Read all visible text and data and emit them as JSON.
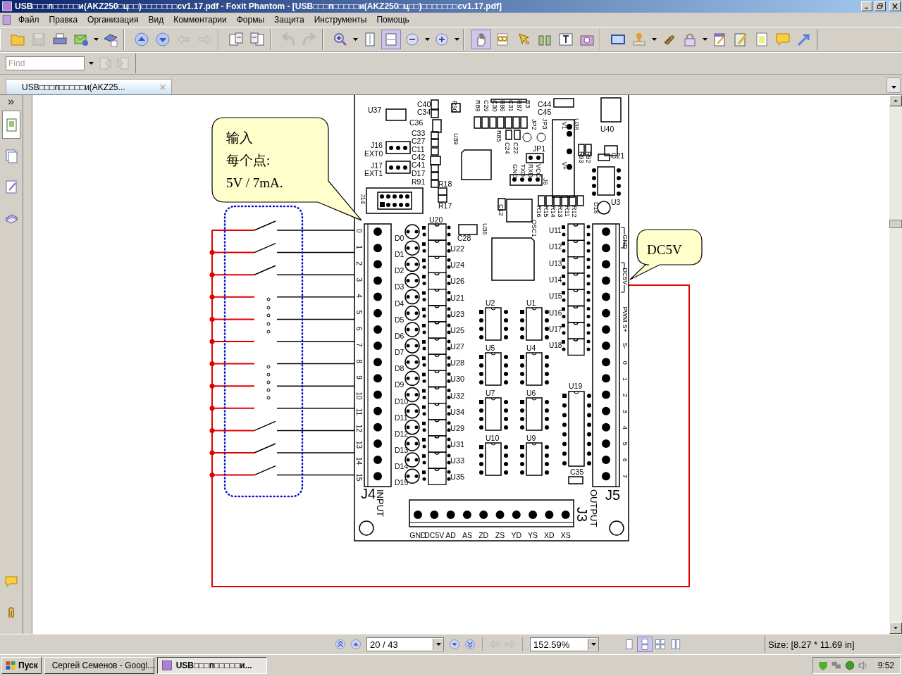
{
  "window": {
    "title": "USB□□□п□□□□□и(AKZ250□ц□□)□□□□□□□cv1.17.pdf - Foxit Phantom - [USB□□□п□□□□□и(AKZ250□ц□□)□□□□□□□cv1.17.pdf]"
  },
  "menu": [
    "Файл",
    "Правка",
    "Организация",
    "Вид",
    "Комментарии",
    "Формы",
    "Защита",
    "Инструменты",
    "Помощь"
  ],
  "toolbar": {
    "groups": [
      {
        "buttons": [
          {
            "selected": false,
            "disabled": false
          },
          {
            "selected": false,
            "disabled": true
          },
          {
            "selected": false,
            "disabled": false
          },
          {
            "selected": false,
            "disabled": false,
            "dropdown": true
          },
          {
            "selected": false,
            "disabled": false
          }
        ]
      },
      {
        "buttons": [
          {
            "selected": false,
            "disabled": false
          },
          {
            "selected": false,
            "disabled": false
          },
          {
            "selected": false,
            "disabled": true
          },
          {
            "selected": false,
            "disabled": true
          }
        ]
      },
      {
        "buttons": [
          {
            "selected": false,
            "disabled": false
          },
          {
            "selected": false,
            "disabled": false
          }
        ]
      },
      {
        "buttons": [
          {
            "selected": false,
            "disabled": true
          },
          {
            "selected": false,
            "disabled": true
          }
        ]
      },
      {
        "buttons": [
          {
            "selected": false,
            "disabled": false,
            "dropdown": true
          },
          {
            "selected": false,
            "disabled": false
          },
          {
            "selected": true,
            "disabled": false
          },
          {
            "selected": false,
            "disabled": false,
            "dropdown": true
          },
          {
            "selected": false,
            "disabled": false,
            "dropdown": true
          }
        ]
      },
      {
        "buttons": [
          {
            "selected": true,
            "disabled": false
          },
          {
            "selected": false,
            "disabled": false
          },
          {
            "selected": false,
            "disabled": false
          },
          {
            "selected": false,
            "disabled": false
          },
          {
            "selected": false,
            "disabled": false
          },
          {
            "selected": false,
            "disabled": false
          }
        ]
      },
      {
        "buttons": [
          {
            "selected": false,
            "disabled": false
          },
          {
            "selected": false,
            "disabled": false,
            "dropdown": true
          },
          {
            "selected": false,
            "disabled": false
          },
          {
            "selected": false,
            "disabled": false,
            "dropdown": true
          },
          {
            "selected": false,
            "disabled": false
          },
          {
            "selected": false,
            "disabled": false
          },
          {
            "selected": false,
            "disabled": false
          },
          {
            "selected": false,
            "disabled": false
          },
          {
            "selected": false,
            "disabled": false
          }
        ]
      }
    ]
  },
  "find": {
    "placeholder": "Find"
  },
  "tabs": [
    {
      "label": "USB□□□п□□□□□и(AKZ25...",
      "selected": true
    }
  ],
  "side_panel": {
    "top": [
      {
        "selected": true
      },
      {
        "selected": false
      },
      {
        "selected": false
      },
      {
        "selected": false
      }
    ],
    "bottom": [
      {
        "selected": false
      },
      {
        "selected": false
      }
    ]
  },
  "document": {
    "callouts": [
      {
        "lines": [
          "输入",
          "每个点:",
          "5V / 7mA."
        ]
      },
      {
        "lines": [
          "DC5V"
        ]
      }
    ],
    "input_pins": [
      "0",
      "1",
      "2",
      "3",
      "4",
      "5",
      "6",
      "7",
      "8",
      "9",
      "10",
      "11",
      "12",
      "13",
      "14",
      "15"
    ],
    "leds": [
      "D0",
      "D1",
      "D2",
      "D3",
      "D4",
      "D5",
      "D6",
      "D7",
      "D8",
      "D9",
      "D10",
      "D11",
      "D12",
      "D13",
      "D14",
      "D15"
    ],
    "optocouplers": [
      "U20",
      "U22",
      "U24",
      "U26",
      "U21",
      "U23",
      "U25",
      "U27",
      "U28",
      "U30",
      "U32",
      "U34",
      "U29",
      "U31",
      "U33",
      "U35"
    ],
    "output_optocouplers": [
      "U11",
      "U12",
      "U13",
      "U14",
      "U15",
      "U16",
      "U17",
      "U18"
    ],
    "ics": [
      "U2",
      "U1",
      "U5",
      "U4",
      "U7",
      "U6",
      "U10",
      "U9",
      "U19"
    ],
    "output_pins": [
      "GND",
      "DC5V",
      "PWM",
      "S+",
      "S-",
      "0",
      "1",
      "2",
      "3",
      "4",
      "5",
      "6",
      "7"
    ],
    "terminal_labels": [
      "GND",
      "DC5V",
      "AD",
      "AS",
      "ZD",
      "ZS",
      "YD",
      "YS",
      "XD",
      "XS"
    ],
    "connector_labels": [
      "J4",
      "INPUT",
      "J5",
      "OUTPUT",
      "J3"
    ],
    "part_labels": [
      "U37",
      "C40",
      "C34",
      "C36",
      "C33",
      "C27",
      "C11",
      "C42",
      "C41",
      "D17",
      "R91",
      "J16",
      "EXT0",
      "J17",
      "EXT1",
      "R18",
      "R17",
      "J14",
      "U39",
      "R90",
      "R89",
      "C29",
      "C30",
      "R86",
      "C31",
      "R87",
      "R3",
      "C44",
      "C45",
      "JP2",
      "JP3",
      "U38",
      "R85",
      "C24",
      "C22",
      "JP1",
      "GND",
      "TXD",
      "RXD",
      "VCC",
      "J6",
      "V1",
      "V+",
      "R92",
      "R93",
      "U40",
      "C21",
      "D16",
      "U3",
      "C12",
      "R16",
      "R15",
      "R14",
      "R13",
      "R11",
      "R12",
      "OSC1",
      "U36",
      "C28",
      "C35"
    ]
  },
  "nav_bar": {
    "page": "20 / 43",
    "zoom": "152.59%",
    "views": [
      {
        "selected": false
      },
      {
        "selected": true
      },
      {
        "selected": false
      },
      {
        "selected": false
      }
    ],
    "size": "Size: [8.27 * 11.69 in]"
  },
  "taskbar": {
    "start": "Пуск",
    "tasks": [
      {
        "label": "Сергей Семенов - Googl...",
        "selected": false
      },
      {
        "label": "USB□□□п□□□□□и...",
        "selected": true
      }
    ],
    "clock": "9:52"
  }
}
